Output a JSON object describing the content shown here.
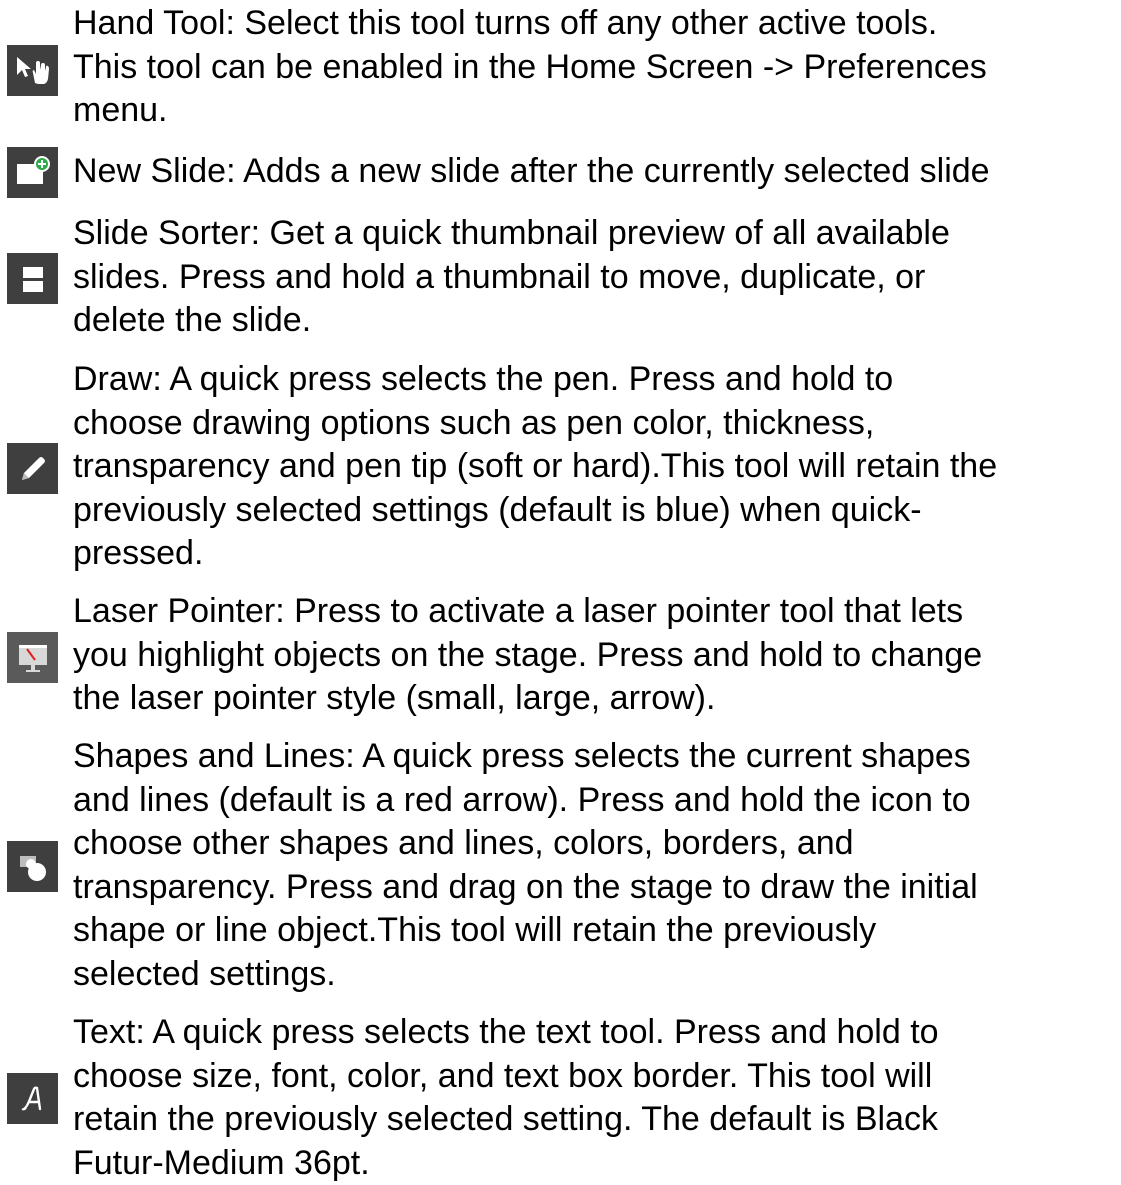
{
  "tools": [
    {
      "icon": "hand-tool-icon",
      "lines": [
        "Hand Tool: Select this tool turns off any other active tools.",
        "This tool can be enabled in the Home Screen -> Preferences",
        "menu."
      ]
    },
    {
      "icon": "new-slide-icon",
      "lines": [
        "New Slide: Adds a new slide after the currently selected slide"
      ]
    },
    {
      "icon": "slide-sorter-icon",
      "lines": [
        "Slide Sorter: Get a quick thumbnail preview of all available",
        "slides. Press and hold a thumbnail to move, duplicate, or",
        "delete the slide."
      ]
    },
    {
      "icon": "draw-pen-icon",
      "lines": [
        "Draw: A quick press selects the pen. Press and hold to",
        "choose drawing options such as pen color, thickness,",
        "transparency and pen tip (soft or hard).This tool will retain the",
        "previously selected settings (default is blue) when quick-",
        "pressed."
      ]
    },
    {
      "icon": "laser-pointer-icon",
      "lines": [
        "Laser Pointer: Press to activate a laser pointer tool that lets",
        "you highlight objects on the stage. Press and hold to change",
        "the laser pointer style (small, large, arrow)."
      ]
    },
    {
      "icon": "shapes-lines-icon",
      "lines": [
        "Shapes and Lines: A quick press selects the current shapes",
        "and lines (default is a red arrow).  Press and hold the icon to",
        "choose other shapes and lines, colors, borders, and",
        "transparency. Press and drag on the stage to draw the initial",
        "shape or line object.This tool will retain the previously",
        "selected settings."
      ]
    },
    {
      "icon": "text-tool-icon",
      "lines": [
        "Text: A quick press selects the text tool. Press and hold to",
        "choose size, font, color, and text box border. This tool will",
        "retain the previously selected setting. The default is Black",
        "Futur-Medium 36pt."
      ]
    }
  ],
  "colors": {
    "icon_background": "#3f3f3f",
    "icon_glyph": "#ffffff",
    "new_slide_accent": "#2eaa4a",
    "laser_accent": "#e02020",
    "text": "#000000"
  }
}
